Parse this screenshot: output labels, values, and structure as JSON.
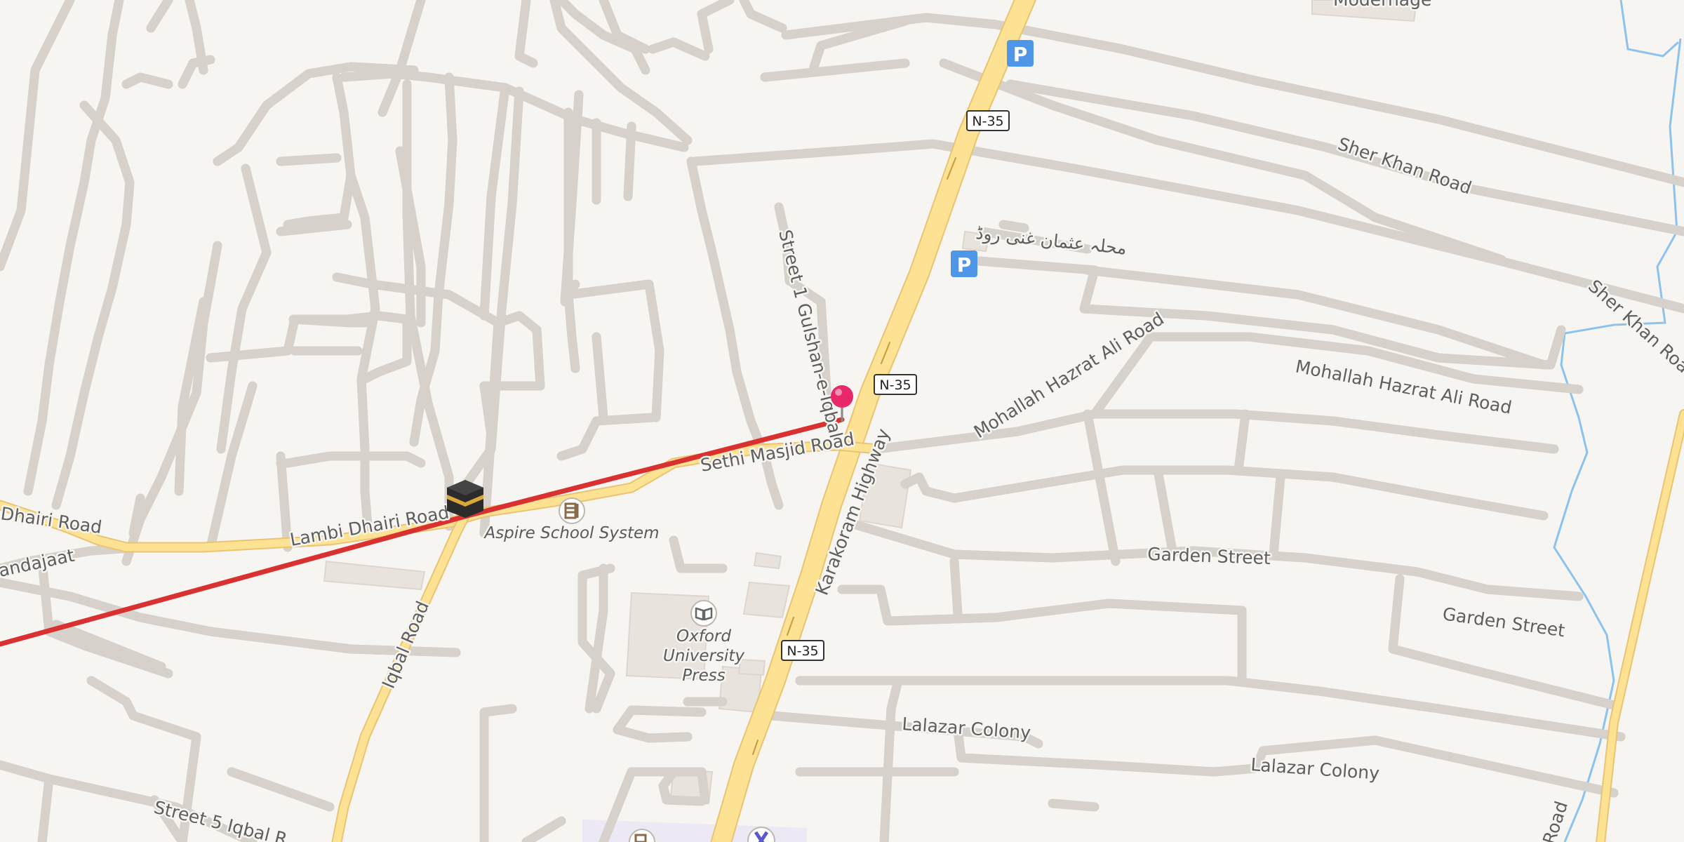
{
  "map": {
    "labels": {
      "sher_khan_road_1": "Sher Khan Road",
      "sher_khan_road_2": "Sher Khan Road",
      "mohallah_usman": "محلہ عثمان غنی روڈ",
      "street_1_gulshan": "Street 1 Gulshan-e-Iqbal",
      "mohallah_hazrat_ali_1": "Mohallah Hazrat Ali Road",
      "mohallah_hazrat_ali_2": "Mohallah Hazrat Ali Road",
      "sethi_masjid_road": "Sethi Masjid Road",
      "karakoram_highway": "Karakoram Highway",
      "lambi_dhairi_road": "Lambi Dhairi Road",
      "dhairi_road": "Dhairi Road",
      "andajaat": "andajaat",
      "iqbal_road": "Iqbal Road",
      "garden_street_1": "Garden Street",
      "garden_street_2": "Garden Street",
      "lalazar_colony_1": "Lalazar Colony",
      "lalazar_colony_2": "Lalazar Colony",
      "street_5_iqbal": "Street 5 Iqbal R...",
      "modernage": "Modernage",
      "road_bottom_right": "Road"
    },
    "pois": {
      "aspire_school": "Aspire School System",
      "oxford_line1": "Oxford",
      "oxford_line2": "University",
      "oxford_line3": "Press"
    },
    "shields": {
      "top": "N-35",
      "middle": "N-35",
      "bottom": "N-35"
    },
    "parking": {
      "symbol": "P"
    },
    "icons": {
      "parking": "parking-icon",
      "mosque": "kaaba-icon",
      "school": "school-icon",
      "bookstore": "book-icon",
      "pin": "map-pin-icon",
      "hospital": "hospital-icon"
    },
    "colors": {
      "background": "#f7f5f1",
      "minor_road": "#ffffff",
      "road_casing": "#d6d1ca",
      "major_road": "#fde293",
      "major_road_casing": "#e9c472",
      "route_line": "#d93030",
      "water": "#8cc2ee",
      "parking": "#4f95e8",
      "pin": "#e8286a",
      "building": "#e8e3dc"
    }
  }
}
